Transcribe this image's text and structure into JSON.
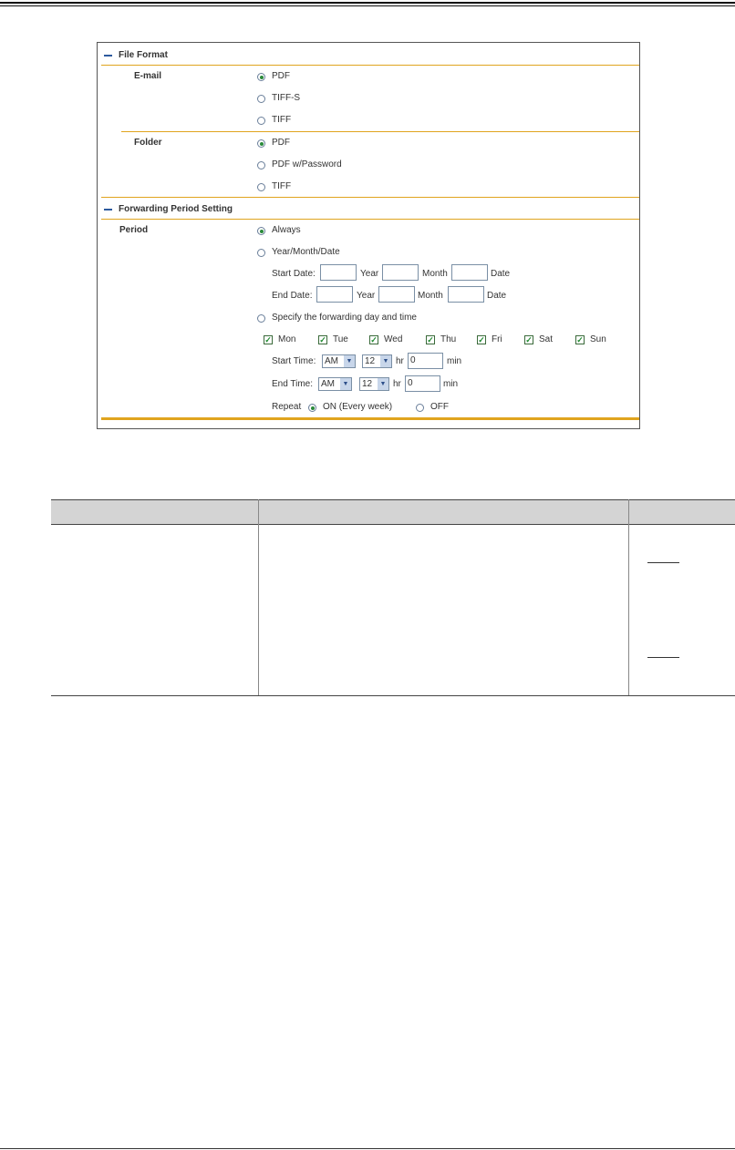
{
  "file_format": {
    "title": "File Format",
    "email": {
      "label": "E-mail",
      "options": [
        "PDF",
        "TIFF-S",
        "TIFF"
      ],
      "selected": "PDF"
    },
    "folder": {
      "label": "Folder",
      "options": [
        "PDF",
        "PDF w/Password",
        "TIFF"
      ],
      "selected": "PDF"
    }
  },
  "forwarding": {
    "title": "Forwarding Period Setting",
    "period_label": "Period",
    "options": [
      "Always",
      "Year/Month/Date",
      "Specify the forwarding day and time"
    ],
    "selected": "Always",
    "start_date": {
      "label": "Start Date:",
      "year": "Year",
      "month": "Month",
      "date": "Date"
    },
    "end_date": {
      "label": "End Date:",
      "year": "Year",
      "month": "Month",
      "date": "Date"
    },
    "days": [
      {
        "name": "Mon",
        "checked": true
      },
      {
        "name": "Tue",
        "checked": true
      },
      {
        "name": "Wed",
        "checked": true
      },
      {
        "name": "Thu",
        "checked": true
      },
      {
        "name": "Fri",
        "checked": true
      },
      {
        "name": "Sat",
        "checked": true
      },
      {
        "name": "Sun",
        "checked": true
      }
    ],
    "start_time": {
      "label": "Start Time:",
      "ampm": "AM",
      "hour": "12",
      "hr_label": "hr",
      "min_value": "0",
      "min_label": "min"
    },
    "end_time": {
      "label": "End Time:",
      "ampm": "AM",
      "hour": "12",
      "hr_label": "hr",
      "min_value": "0",
      "min_label": "min"
    },
    "repeat": {
      "label": "Repeat",
      "on_label": "ON (Every week)",
      "off_label": "OFF",
      "selected": "ON (Every week)"
    }
  },
  "colors": {
    "accent_gold": "#e0a41e",
    "section_dash": "#2d5a9e",
    "radio_dot": "#2a8a3a",
    "check": "#1e8a2e"
  },
  "icons": {
    "checkmark": "✓",
    "dropdown_arrow": "▼"
  }
}
